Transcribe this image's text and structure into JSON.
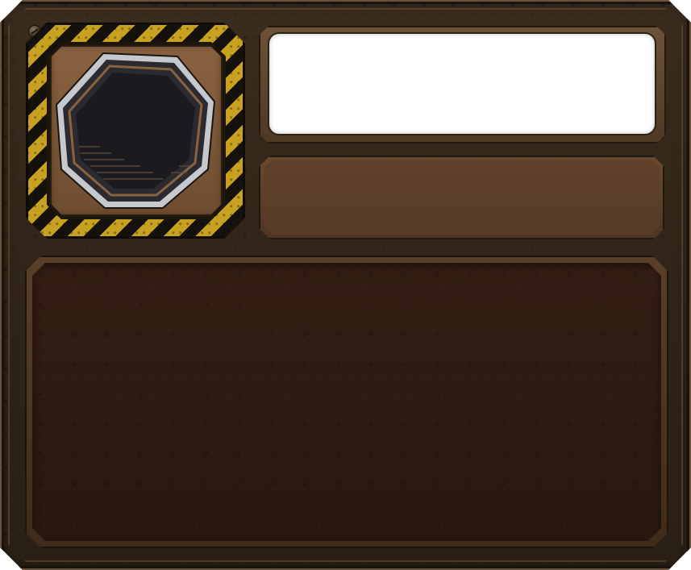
{
  "panel": {
    "portrait": {
      "icon": "octagon-portrait-icon",
      "image_label": ""
    },
    "name_plate": {
      "text": ""
    },
    "subtitle_bar": {
      "text": ""
    },
    "body": {
      "text": ""
    }
  },
  "colors": {
    "frame": "#2f2418",
    "hazard_yellow": "#c9a120",
    "hazard_black": "#15110c",
    "portrait_bg": "#7a5636",
    "name_plate": "#ffffff",
    "subtitle_bar": "#5e402a",
    "body_panel": "#2d1a11"
  }
}
